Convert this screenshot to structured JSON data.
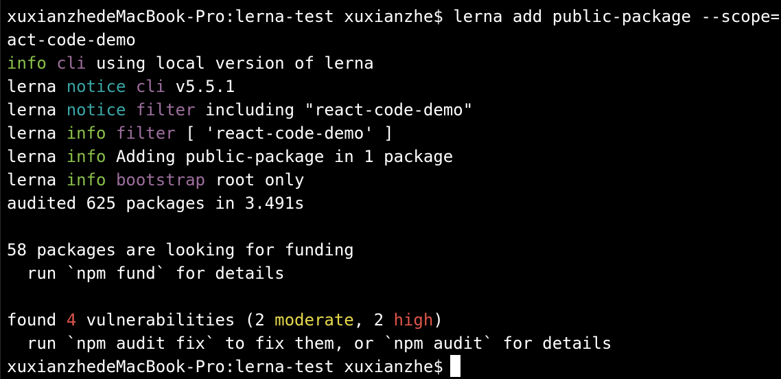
{
  "terminal": {
    "lines": [
      [
        {
          "text": "xuxianzhedeMacBook-Pro:lerna-test xuxianzhe$ lerna add public-package --scope=re",
          "color": "default"
        }
      ],
      [
        {
          "text": "act-code-demo",
          "color": "default"
        }
      ],
      [
        {
          "text": "info",
          "color": "green"
        },
        {
          "text": " ",
          "color": "default"
        },
        {
          "text": "cli",
          "color": "purple"
        },
        {
          "text": " using local version of lerna",
          "color": "default"
        }
      ],
      [
        {
          "text": "lerna ",
          "color": "default"
        },
        {
          "text": "notice",
          "color": "cyan"
        },
        {
          "text": " ",
          "color": "default"
        },
        {
          "text": "cli",
          "color": "purple"
        },
        {
          "text": " v5.5.1",
          "color": "default"
        }
      ],
      [
        {
          "text": "lerna ",
          "color": "default"
        },
        {
          "text": "notice",
          "color": "cyan"
        },
        {
          "text": " ",
          "color": "default"
        },
        {
          "text": "filter",
          "color": "purple"
        },
        {
          "text": " including \"react-code-demo\"",
          "color": "default"
        }
      ],
      [
        {
          "text": "lerna ",
          "color": "default"
        },
        {
          "text": "info",
          "color": "green"
        },
        {
          "text": " ",
          "color": "default"
        },
        {
          "text": "filter",
          "color": "purple"
        },
        {
          "text": " [ 'react-code-demo' ]",
          "color": "default"
        }
      ],
      [
        {
          "text": "lerna ",
          "color": "default"
        },
        {
          "text": "info",
          "color": "green"
        },
        {
          "text": " Adding public-package in 1 package",
          "color": "default"
        }
      ],
      [
        {
          "text": "lerna ",
          "color": "default"
        },
        {
          "text": "info",
          "color": "green"
        },
        {
          "text": " ",
          "color": "default"
        },
        {
          "text": "bootstrap",
          "color": "purple"
        },
        {
          "text": " root only",
          "color": "default"
        }
      ],
      [
        {
          "text": "audited 625 packages in 3.491s",
          "color": "default"
        }
      ],
      [],
      [
        {
          "text": "58 packages are looking for funding",
          "color": "default"
        }
      ],
      [
        {
          "text": "  run `npm fund` for details",
          "color": "default"
        }
      ],
      [],
      [
        {
          "text": "found ",
          "color": "default"
        },
        {
          "text": "4",
          "color": "red"
        },
        {
          "text": " vulnerabilities (2 ",
          "color": "default"
        },
        {
          "text": "moderate",
          "color": "yellow"
        },
        {
          "text": ", 2 ",
          "color": "default"
        },
        {
          "text": "high",
          "color": "red"
        },
        {
          "text": ")",
          "color": "default"
        }
      ],
      [
        {
          "text": "  run `npm audit fix` to fix them, or `npm audit` for details",
          "color": "default"
        }
      ]
    ],
    "prompt": "xuxianzhedeMacBook-Pro:lerna-test xuxianzhe$",
    "colors": {
      "background": "#000000",
      "default": "#ffffff",
      "green": "#8ac04a",
      "purple": "#9e6f9e",
      "cyan": "#3aa6a6",
      "red": "#e0554b",
      "yellow": "#e6d94c"
    }
  }
}
